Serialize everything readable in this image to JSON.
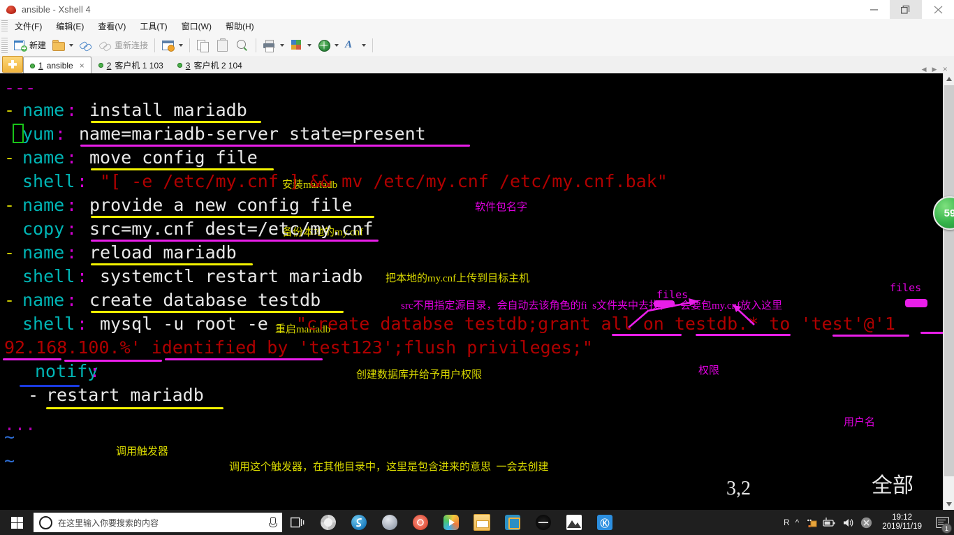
{
  "window": {
    "title": "ansible - Xshell 4",
    "app_icon": "xshell-icon",
    "minimize": "minimize-icon",
    "maximize": "restore-icon",
    "close": "close-icon"
  },
  "menubar": [
    {
      "label": "文件(F)"
    },
    {
      "label": "编辑(E)"
    },
    {
      "label": "查看(V)"
    },
    {
      "label": "工具(T)"
    },
    {
      "label": "窗口(W)"
    },
    {
      "label": "帮助(H)"
    }
  ],
  "toolbar": {
    "new_label": "新建",
    "reconnect_label": "重新连接"
  },
  "tabs": {
    "add_label": "+",
    "items": [
      {
        "num": "1",
        "label": "ansible",
        "active": true,
        "closable": true
      },
      {
        "num": "2",
        "label": "客户机 1 103",
        "active": false,
        "closable": false
      },
      {
        "num": "3",
        "label": "客户机 2 104",
        "active": false,
        "closable": false
      }
    ]
  },
  "terminal": {
    "lines": [
      {
        "dash": "",
        "key": "",
        "colon": "",
        "value": "---",
        "type": "sep"
      },
      {
        "dash": "-",
        "key": "name",
        "colon": ":",
        "value": "install mariadb"
      },
      {
        "dash": " ",
        "key": "yum",
        "colon": ":",
        "value": "name=mariadb-server state=present"
      },
      {
        "dash": "-",
        "key": "name",
        "colon": ":",
        "value": "move config file"
      },
      {
        "dash": " ",
        "key": "shell",
        "colon": ":",
        "value": "\"[ -e /etc/my.cnf ] && mv /etc/my.cnf /etc/my.cnf.bak\"",
        "string": true
      },
      {
        "dash": "-",
        "key": "name",
        "colon": ":",
        "value": "provide a new config file"
      },
      {
        "dash": " ",
        "key": "copy",
        "colon": ":",
        "value": "src=my.cnf dest=/etc/my.cnf"
      },
      {
        "dash": "-",
        "key": "name",
        "colon": ":",
        "value": "reload mariadb"
      },
      {
        "dash": " ",
        "key": "shell",
        "colon": ":",
        "value": "systemctl restart mariadb"
      },
      {
        "dash": "-",
        "key": "name",
        "colon": ":",
        "value": "create database testdb"
      },
      {
        "dash": " ",
        "key": "shell",
        "colon": ":",
        "value": "mysql -u root -e "
      },
      {
        "dash": " ",
        "key": "notify",
        "colon": ":",
        "value": ""
      },
      {
        "dash": "-",
        "key": "",
        "colon": "",
        "value": "restart mariadb"
      }
    ],
    "shell_mysql_cmd": "mysql -u root -e ",
    "shell_mysql_str1": "\"create databse testdb;grant all on testdb.* to 'test'@'1",
    "shell_mysql_str2": "92.168.100.%' identified by 'test123';flush privileges;\"",
    "tail_dots": "...",
    "tilde1": "~",
    "tilde2": "~",
    "status_position": "3,2",
    "status_scroll": "全部"
  },
  "annotations": {
    "install_mariadb": "安装mariadb",
    "package_name": "软件包名字",
    "backup_mycnf": "备份本地的my.cnf",
    "upload_mycnf": "把本地的my.cnf上传到目标主机",
    "src_note": "src不用指定源目录，会自动去该角色的fi  s文件夹中去找，一会要包my.cnf放入这里",
    "files_label_1": "files",
    "files_label_2": "files",
    "restart_mariadb": "重启mariadb",
    "create_db_grant": "创建数据库并给予用户权限",
    "privilege": "权限",
    "username": "用户名",
    "call_trigger": "调用触发器",
    "trigger_note": "调用这个触发器，在其他目录中，这里是包含进来的意思  一会去创建"
  },
  "floating_badge": {
    "count": "59"
  },
  "taskbar": {
    "start": "windows-start-icon",
    "search_placeholder": "在这里输入你要搜索的内容",
    "mic": "microphone-icon",
    "task_view": "task-view-icon",
    "apps": [
      {
        "name": "app-pinwheel"
      },
      {
        "name": "app-sogou"
      },
      {
        "name": "app-globe"
      },
      {
        "name": "app-snail"
      },
      {
        "name": "app-player"
      },
      {
        "name": "app-explorer"
      },
      {
        "name": "app-vmware"
      },
      {
        "name": "app-dark"
      },
      {
        "name": "app-photos"
      },
      {
        "name": "app-kugou"
      }
    ],
    "tray": {
      "ime": "R",
      "chevron": "^",
      "qq": "qq-penguin-icon",
      "battery": "battery-icon",
      "volume": "volume-icon",
      "error": "error-icon"
    },
    "clock_time": "19:12",
    "clock_date": "2019/11/19",
    "notification_count": "1"
  },
  "colors": {
    "terminal_bg": "#000000",
    "key_cyan": "#00b5b5",
    "colon_magenta": "#d000d0",
    "value_white": "#e8e8e8",
    "string_red": "#b00000",
    "dash_yellow": "#c9c900",
    "ink_yellow": "#d8d800",
    "ink_magenta": "#e000e0",
    "ink_blue": "#1a3ae0",
    "badge_green": "#36b44b"
  }
}
